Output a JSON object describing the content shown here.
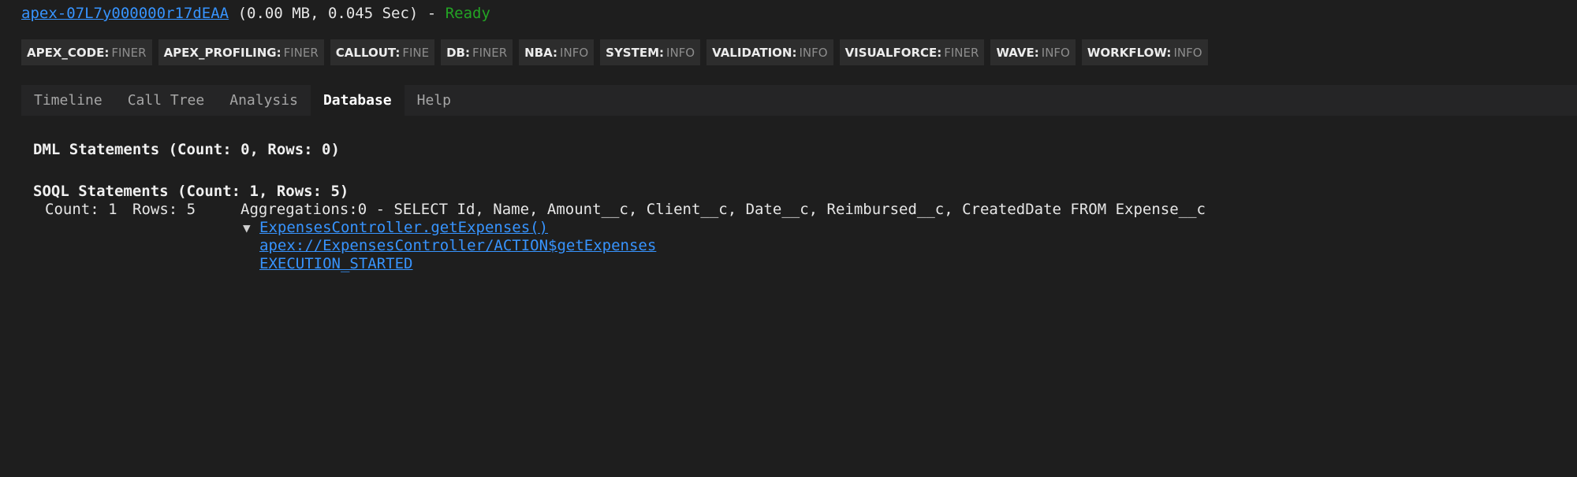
{
  "header": {
    "log_id": "apex-07L7y000000r17dEAA",
    "meta": "(0.00 MB, 0.045 Sec) -",
    "status": "Ready",
    "status_color": "#23a424"
  },
  "log_levels": [
    {
      "key": "APEX_CODE:",
      "value": "FINER"
    },
    {
      "key": "APEX_PROFILING:",
      "value": "FINER"
    },
    {
      "key": "CALLOUT:",
      "value": "FINE"
    },
    {
      "key": "DB:",
      "value": "FINER"
    },
    {
      "key": "NBA:",
      "value": "INFO"
    },
    {
      "key": "SYSTEM:",
      "value": "INFO"
    },
    {
      "key": "VALIDATION:",
      "value": "INFO"
    },
    {
      "key": "VISUALFORCE:",
      "value": "FINER"
    },
    {
      "key": "WAVE:",
      "value": "INFO"
    },
    {
      "key": "WORKFLOW:",
      "value": "INFO"
    }
  ],
  "tabs": [
    {
      "label": "Timeline",
      "active": false
    },
    {
      "label": "Call Tree",
      "active": false
    },
    {
      "label": "Analysis",
      "active": false
    },
    {
      "label": "Database",
      "active": true
    },
    {
      "label": "Help",
      "active": false
    }
  ],
  "database": {
    "dml_title": "DML Statements (Count: 0, Rows: 0)",
    "soql_title": "SOQL Statements (Count: 1, Rows: 5)",
    "soql_rows": [
      {
        "count": "Count: 1",
        "rows": "Rows: 5",
        "query": "Aggregations:0 - SELECT Id, Name, Amount__c, Client__c, Date__c, Reimbursed__c, CreatedDate FROM Expense__c",
        "stack_arrow": "▼",
        "stack": [
          "ExpensesController.getExpenses()",
          "apex://ExpensesController/ACTION$getExpenses",
          "EXECUTION_STARTED"
        ]
      }
    ]
  }
}
